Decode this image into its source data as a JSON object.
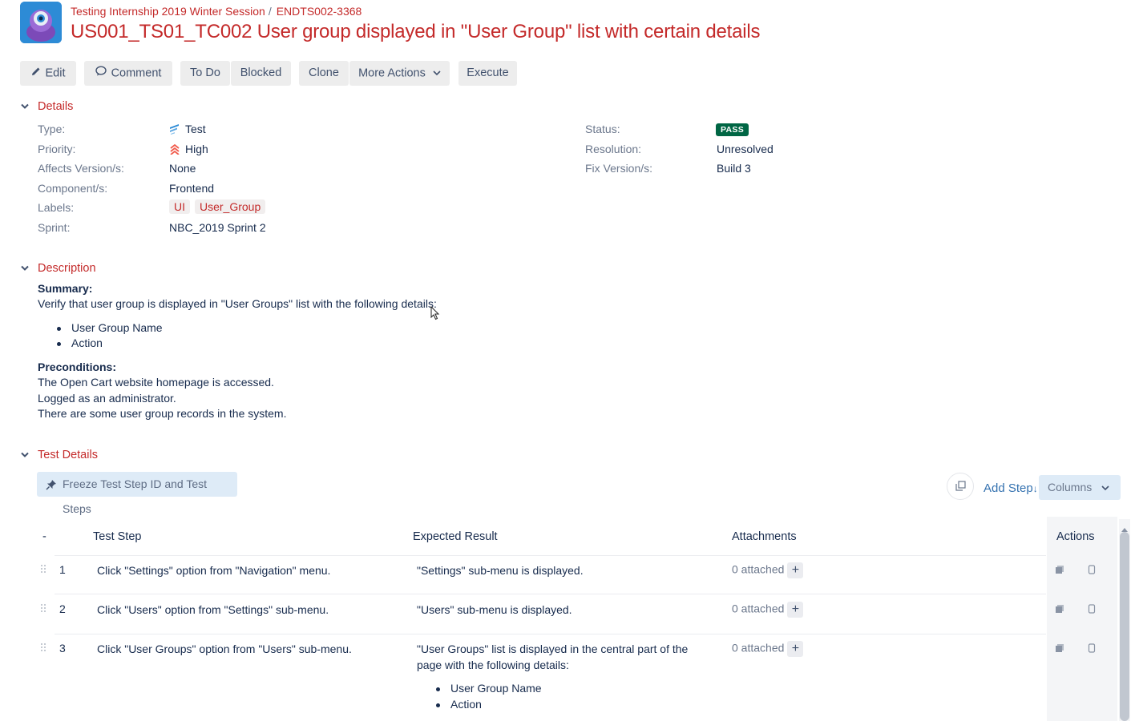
{
  "breadcrumb": {
    "project": "Testing Internship 2019 Winter Session",
    "separator": "/",
    "issue_key": "ENDTS002-3368"
  },
  "title": "US001_TS01_TC002 User group displayed in \"User Group\" list with certain details",
  "toolbar": {
    "edit": "Edit",
    "comment": "Comment",
    "todo": "To Do",
    "blocked": "Blocked",
    "clone": "Clone",
    "more_actions": "More Actions",
    "execute": "Execute"
  },
  "details": {
    "heading": "Details",
    "type_label": "Type:",
    "type_value": "Test",
    "priority_label": "Priority:",
    "priority_value": "High",
    "affects_label": "Affects Version/s:",
    "affects_value": "None",
    "component_label": "Component/s:",
    "component_value": "Frontend",
    "labels_label": "Labels:",
    "labels": [
      "UI",
      "User_Group"
    ],
    "sprint_label": "Sprint:",
    "sprint_value": "NBC_2019 Sprint 2",
    "status_label": "Status:",
    "status_value": "PASS",
    "resolution_label": "Resolution:",
    "resolution_value": "Unresolved",
    "fix_label": "Fix Version/s:",
    "fix_value": "Build 3"
  },
  "description": {
    "heading": "Description",
    "summary_title": "Summary:",
    "summary_text": "Verify that user group is displayed in \"User Groups\" list with the following details:",
    "summary_bullets": [
      "User Group Name",
      "Action"
    ],
    "preconditions_title": "Preconditions:",
    "preconditions": [
      "The Open Cart website homepage is accessed.",
      "Logged as an administrator.",
      "There are some user group records in the system."
    ]
  },
  "test_details": {
    "heading": "Test Details",
    "freeze_button": "Freeze Test Step ID and Test Steps",
    "add_step": "Add Step",
    "columns_button": "Columns",
    "headers": {
      "index": "-",
      "step": "Test Step",
      "expected": "Expected Result",
      "attachments": "Attachments",
      "actions": "Actions"
    },
    "rows": [
      {
        "num": "1",
        "step": "Click \"Settings\" option from \"Navigation\" menu.",
        "expected": "\"Settings\" sub-menu is displayed.",
        "attachments": "0 attached"
      },
      {
        "num": "2",
        "step": "Click \"Users\" option from \"Settings\" sub-menu.",
        "expected": "\"Users\" sub-menu is displayed.",
        "attachments": "0 attached"
      },
      {
        "num": "3",
        "step": "Click \"User Groups\" option from \"Users\" sub-menu.",
        "expected_lines": [
          "\"User Groups\" list is displayed in the central part of the",
          "page with the following details:"
        ],
        "expected_bullets": [
          "User Group Name",
          "Action"
        ],
        "attachments": "0 attached"
      }
    ]
  },
  "colors": {
    "accent": "#c42a2a",
    "pass": "#006644",
    "link_blue": "#3572b0"
  }
}
